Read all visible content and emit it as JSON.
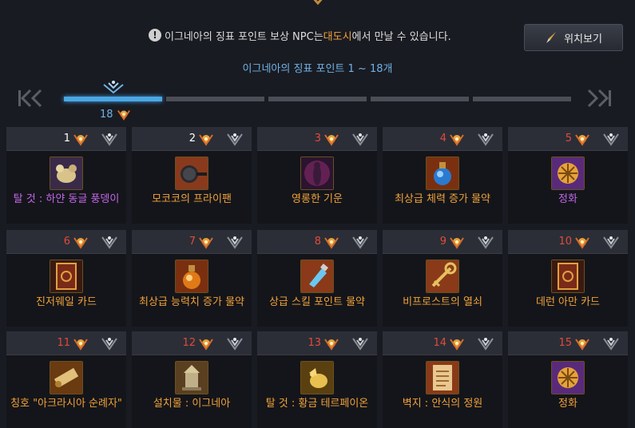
{
  "notice": {
    "icon": "info-icon",
    "before": "이그네아의 징표 포인트 보상 NPC는 ",
    "highlight": "대도시",
    "after": "에서 만날 수 있습니다."
  },
  "location_button": {
    "label": "위치보기",
    "icon": "compass-needle-icon"
  },
  "range_title": "이그네아의 징표 포인트 1 ~ 18개",
  "current_points": "18",
  "progress": {
    "segments": 5,
    "filled_segments": 1
  },
  "colors": {
    "accent": "#4ba7e4",
    "orange": "#f0a23a",
    "purple": "#c266e8",
    "red": "#e24a3c"
  },
  "rewards": [
    {
      "number": "1",
      "name": "탈 것 : 하얀 동글 풍뎅이",
      "color": "purple",
      "number_color": "white",
      "icon": "beetle-mount-icon"
    },
    {
      "number": "2",
      "name": "모코코의 프라이팬",
      "color": "orange",
      "number_color": "white",
      "icon": "frying-pan-icon"
    },
    {
      "number": "3",
      "name": "영롱한 기운",
      "color": "orange",
      "number_color": "red",
      "icon": "glowing-aura-icon"
    },
    {
      "number": "4",
      "name": "최상급 체력 증가 물약",
      "color": "orange",
      "number_color": "red",
      "icon": "health-potion-icon"
    },
    {
      "number": "5",
      "name": "정화",
      "color": "purple",
      "number_color": "red",
      "icon": "purify-rune-icon"
    },
    {
      "number": "6",
      "name": "진저웨일 카드",
      "color": "orange",
      "number_color": "red",
      "icon": "card-icon"
    },
    {
      "number": "7",
      "name": "최상급 능력치 증가 물약",
      "color": "orange",
      "number_color": "red",
      "icon": "stat-potion-icon"
    },
    {
      "number": "8",
      "name": "상급 스킬 포인트 물약",
      "color": "orange",
      "number_color": "red",
      "icon": "skill-potion-icon"
    },
    {
      "number": "9",
      "name": "비프로스트의 열쇠",
      "color": "orange",
      "number_color": "red",
      "icon": "key-icon"
    },
    {
      "number": "10",
      "name": "데런 아만 카드",
      "color": "orange",
      "number_color": "red",
      "icon": "card-icon"
    },
    {
      "number": "11",
      "name": "칭호 \"아크라시아 순례자\"",
      "color": "orange",
      "number_color": "red",
      "icon": "scroll-icon"
    },
    {
      "number": "12",
      "name": "설치물 : 이그네아",
      "color": "orange",
      "number_color": "red",
      "icon": "statue-icon"
    },
    {
      "number": "13",
      "name": "탈 것 : 황금 테르페이온",
      "color": "orange",
      "number_color": "red",
      "icon": "golden-mount-icon"
    },
    {
      "number": "14",
      "name": "벽지 : 안식의 정원",
      "color": "orange",
      "number_color": "red",
      "icon": "wallpaper-icon"
    },
    {
      "number": "15",
      "name": "정화",
      "color": "orange",
      "number_color": "red",
      "icon": "purify-rune-icon"
    }
  ]
}
